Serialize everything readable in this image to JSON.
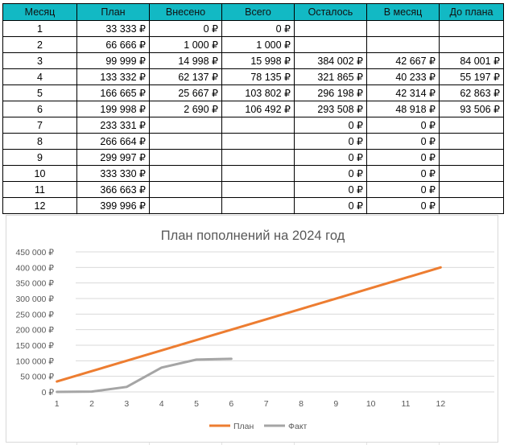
{
  "table": {
    "headers": [
      "Месяц",
      "План",
      "Внесено",
      "Всего",
      "Осталось",
      "В месяц",
      "До плана"
    ],
    "rows": [
      [
        "1",
        "33 333 ₽",
        "0 ₽",
        "0 ₽",
        "",
        "",
        ""
      ],
      [
        "2",
        "66 666 ₽",
        "1 000 ₽",
        "1 000 ₽",
        "",
        "",
        ""
      ],
      [
        "3",
        "99 999 ₽",
        "14 998 ₽",
        "15 998 ₽",
        "384 002 ₽",
        "42 667 ₽",
        "84 001 ₽"
      ],
      [
        "4",
        "133 332 ₽",
        "62 137 ₽",
        "78 135 ₽",
        "321 865 ₽",
        "40 233 ₽",
        "55 197 ₽"
      ],
      [
        "5",
        "166 665 ₽",
        "25 667 ₽",
        "103 802 ₽",
        "296 198 ₽",
        "42 314 ₽",
        "62 863 ₽"
      ],
      [
        "6",
        "199 998 ₽",
        "2 690 ₽",
        "106 492 ₽",
        "293 508 ₽",
        "48 918 ₽",
        "93 506 ₽"
      ],
      [
        "7",
        "233 331 ₽",
        "",
        "",
        "0 ₽",
        "0 ₽",
        ""
      ],
      [
        "8",
        "266 664 ₽",
        "",
        "",
        "0 ₽",
        "0 ₽",
        ""
      ],
      [
        "9",
        "299 997 ₽",
        "",
        "",
        "0 ₽",
        "0 ₽",
        ""
      ],
      [
        "10",
        "333 330 ₽",
        "",
        "",
        "0 ₽",
        "0 ₽",
        ""
      ],
      [
        "11",
        "366 663 ₽",
        "",
        "",
        "0 ₽",
        "0 ₽",
        ""
      ],
      [
        "12",
        "399 996 ₽",
        "",
        "",
        "0 ₽",
        "0 ₽",
        ""
      ]
    ]
  },
  "colors": {
    "header_bg": "#12b9c4",
    "plan_line": "#ed7d31",
    "fact_line": "#a5a5a5",
    "gridline": "#d9d9d9",
    "axis_text": "#595959"
  },
  "chart_data": {
    "type": "line",
    "title": "План пополнений на 2024 год",
    "x": [
      1,
      2,
      3,
      4,
      5,
      6,
      7,
      8,
      9,
      10,
      11,
      12
    ],
    "x_tick_labels": [
      "1",
      "2",
      "3",
      "4",
      "5",
      "6",
      "7",
      "8",
      "9",
      "10",
      "11",
      "12"
    ],
    "series": [
      {
        "name": "План",
        "x": [
          1,
          2,
          3,
          4,
          5,
          6,
          7,
          8,
          9,
          10,
          11,
          12
        ],
        "values": [
          33333,
          66666,
          99999,
          133332,
          166665,
          199998,
          233331,
          266664,
          299997,
          333330,
          366663,
          399996
        ]
      },
      {
        "name": "Факт",
        "x": [
          1,
          2,
          3,
          4,
          5,
          6
        ],
        "values": [
          0,
          1000,
          15998,
          78135,
          103802,
          106492
        ]
      }
    ],
    "ylim": [
      0,
      450000
    ],
    "y_ticks": [
      0,
      50000,
      100000,
      150000,
      200000,
      250000,
      300000,
      350000,
      400000,
      450000
    ],
    "y_tick_labels": [
      "0 ₽",
      "50 000 ₽",
      "100 000 ₽",
      "150 000 ₽",
      "200 000 ₽",
      "250 000 ₽",
      "300 000 ₽",
      "350 000 ₽",
      "400 000 ₽",
      "450 000 ₽"
    ],
    "grid": true,
    "legend_position": "bottom"
  }
}
